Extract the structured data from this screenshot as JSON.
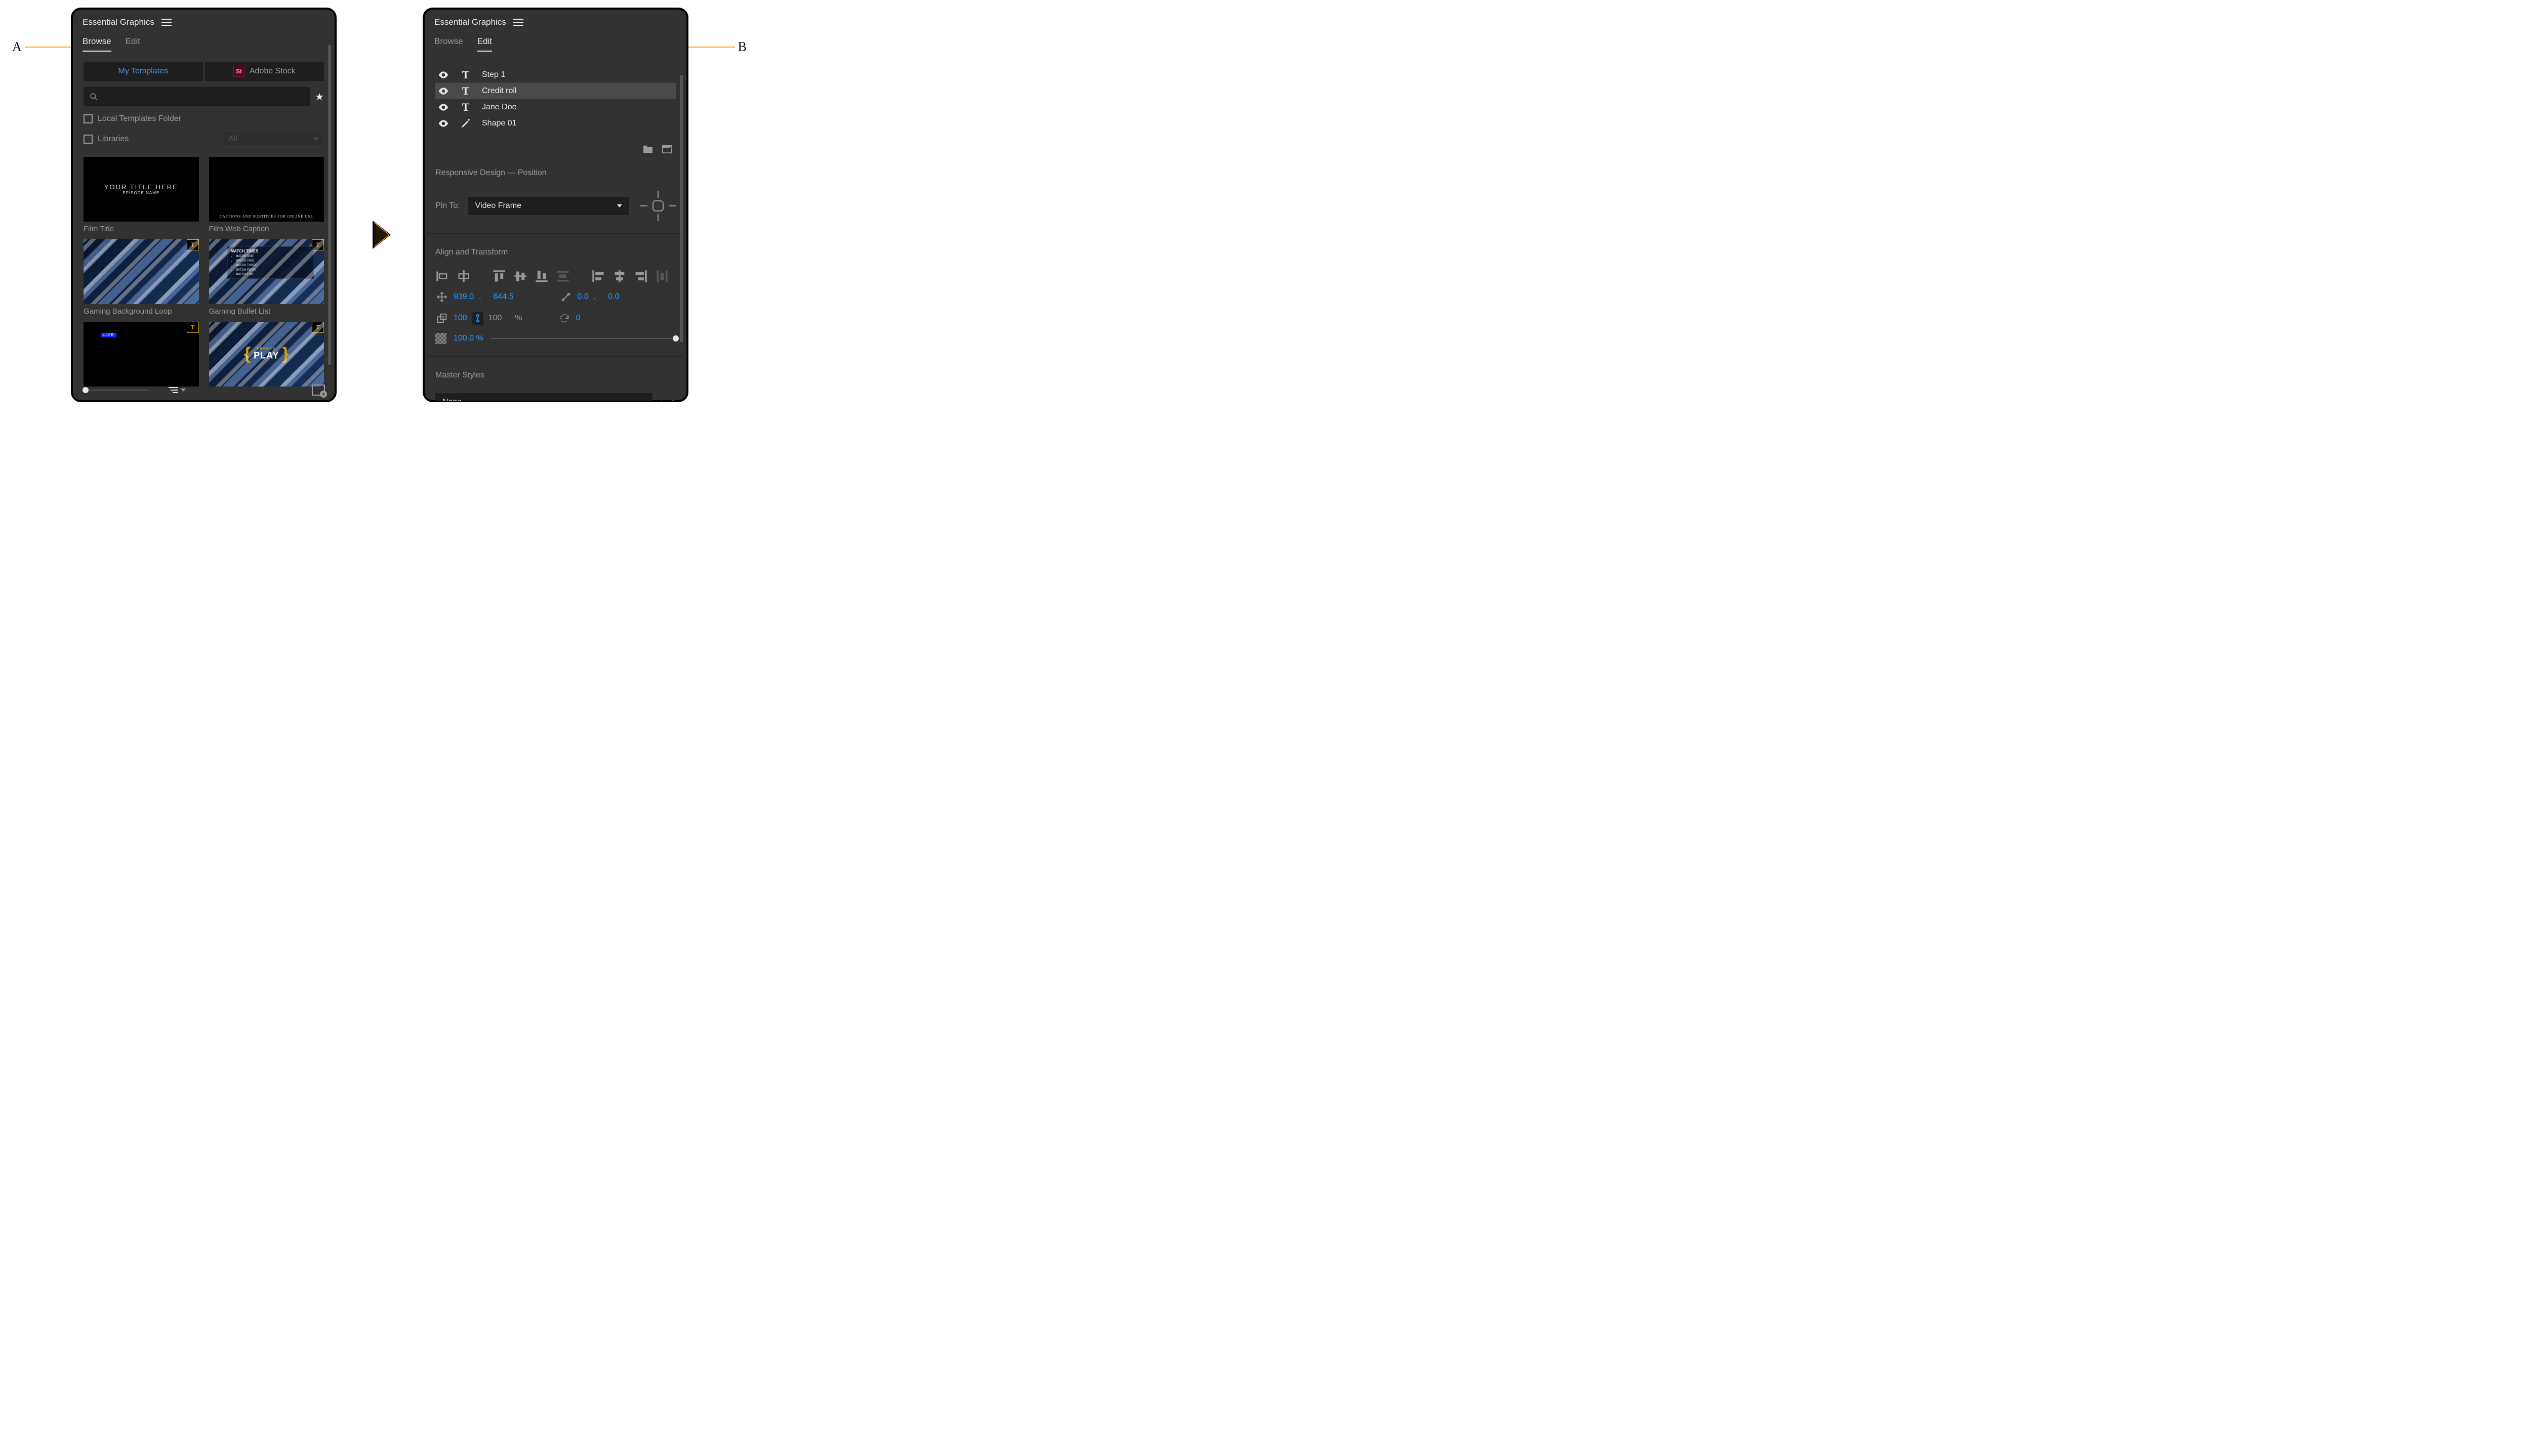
{
  "callouts": {
    "a": "A",
    "b": "B"
  },
  "panelA": {
    "title": "Essential Graphics",
    "tabs": {
      "browse": "Browse",
      "edit": "Edit",
      "active": "browse"
    },
    "sources": {
      "my_templates": "My Templates",
      "adobe_stock": "Adobe Stock"
    },
    "filters": {
      "local_templates": "Local Templates Folder",
      "libraries": "Libraries",
      "libraries_dropdown": "All"
    },
    "templates": [
      {
        "name": "Film Title",
        "title": "YOUR TITLE HERE",
        "subtitle": "EPISODE NAME"
      },
      {
        "name": "Film Web Caption",
        "overlay": "CAPTIONS AND SUBTITLES FOR ONLINE USE"
      },
      {
        "name": "Gaming Background Loop"
      },
      {
        "name": "Gaming Bullet List",
        "header": "MATCH TIMES",
        "items": [
          "MATCH ONE",
          "MATCH TWO",
          "MATCH THREE",
          "MATCH FOUR",
          "MATCH FIVE"
        ]
      },
      {
        "name": "",
        "live": "LIVE"
      },
      {
        "name": "",
        "league": "LEAGUE",
        "play": "PLAY"
      }
    ]
  },
  "panelB": {
    "title": "Essential Graphics",
    "tabs": {
      "browse": "Browse",
      "edit": "Edit",
      "active": "edit"
    },
    "layers": [
      {
        "name": "Step 1",
        "type": "T",
        "selected": false
      },
      {
        "name": "Credit roll",
        "type": "T",
        "selected": true
      },
      {
        "name": "Jane Doe",
        "type": "T",
        "selected": false
      },
      {
        "name": "Shape 01",
        "type": "pen",
        "selected": false
      }
    ],
    "responsive": {
      "header": "Responsive Design — Position",
      "pin_label": "Pin To:",
      "pin_value": "Video Frame"
    },
    "align": {
      "header": "Align and Transform"
    },
    "transform": {
      "pos_x": "939.0",
      "pos_y": "644.5",
      "anchor_x": "0.0",
      "anchor_y": "0.0",
      "scale_w": "100",
      "scale_h": "100",
      "scale_unit": "%",
      "rotation": "0",
      "opacity": "100.0",
      "opacity_unit": "%"
    },
    "master": {
      "header": "Master Styles",
      "value": "None"
    }
  }
}
